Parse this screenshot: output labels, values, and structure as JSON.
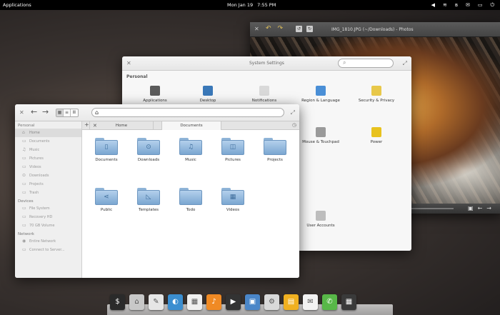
{
  "panel": {
    "applications_label": "Applications",
    "date": "Mon Jan 19",
    "time": "7:55 PM",
    "indicators": [
      {
        "icon": "volume-icon",
        "glyph": "◀"
      },
      {
        "icon": "wifi-icon",
        "glyph": "≋"
      },
      {
        "icon": "bluetooth-icon",
        "glyph": "ʙ"
      },
      {
        "icon": "mail-icon",
        "glyph": "✉"
      },
      {
        "icon": "battery-icon",
        "glyph": "▭"
      },
      {
        "icon": "power-icon",
        "glyph": "⏻"
      }
    ]
  },
  "photos": {
    "title": "IMG_1810.JPG (~/Downloads) - Photos"
  },
  "settings": {
    "title": "System Settings",
    "search_placeholder": "",
    "personal_section": "Personal",
    "items": [
      {
        "name": "settings-applications",
        "label": "Applications",
        "color": "#5a5a5a"
      },
      {
        "name": "settings-desktop",
        "label": "Desktop",
        "color": "#3a78b8"
      },
      {
        "name": "settings-notifications",
        "label": "Notifications",
        "color": "#d9d9d9"
      },
      {
        "name": "settings-region-language",
        "label": "Region & Language",
        "color": "#4a8fd6"
      },
      {
        "name": "settings-security-privacy",
        "label": "Security & Privacy",
        "color": "#e8c84a"
      },
      {
        "name": "settings-mouse-touchpad",
        "label": "Mouse & Touchpad",
        "color": "#9a9a9a"
      },
      {
        "name": "settings-power",
        "label": "Power",
        "color": "#e8c21e"
      },
      {
        "name": "settings-user-accounts",
        "label": "User Accounts",
        "color": "#bdbdbd"
      }
    ]
  },
  "files": {
    "sidebar": {
      "personal": "Personal",
      "personal_items": [
        {
          "label": "Home",
          "glyph": "⌂"
        },
        {
          "label": "Documents",
          "glyph": "▭"
        },
        {
          "label": "Music",
          "glyph": "♫"
        },
        {
          "label": "Pictures",
          "glyph": "▭"
        },
        {
          "label": "Videos",
          "glyph": "▭"
        },
        {
          "label": "Downloads",
          "glyph": "⊙"
        },
        {
          "label": "Projects",
          "glyph": "▭"
        },
        {
          "label": "Trash",
          "glyph": "▭"
        }
      ],
      "devices": "Devices",
      "device_items": [
        {
          "label": "File System",
          "glyph": "▭"
        },
        {
          "label": "Recovery HD",
          "glyph": "▭"
        },
        {
          "label": "70 GB Volume",
          "glyph": "▭"
        }
      ],
      "network": "Network",
      "network_items": [
        {
          "label": "Entire Network",
          "glyph": "◉"
        },
        {
          "label": "Connect to Server...",
          "glyph": "▭"
        }
      ]
    },
    "tabs": [
      {
        "label": "Home"
      },
      {
        "label": "Documents"
      }
    ],
    "folders": [
      {
        "label": "Documents",
        "glyph": "▯"
      },
      {
        "label": "Downloads",
        "glyph": "⊙"
      },
      {
        "label": "Music",
        "glyph": "♫"
      },
      {
        "label": "Pictures",
        "glyph": "◫"
      },
      {
        "label": "Projects",
        "glyph": ""
      },
      {
        "label": "Public",
        "glyph": "⋖"
      },
      {
        "label": "Templates",
        "glyph": "◺"
      },
      {
        "label": "Todo",
        "glyph": ""
      },
      {
        "label": "Videos",
        "glyph": "▦"
      }
    ]
  },
  "dock": {
    "apps": [
      {
        "name": "dock-terminal",
        "color": "#2a2a2a",
        "glyph": "$"
      },
      {
        "name": "dock-files",
        "color": "#c8c8c8",
        "glyph": "⌂"
      },
      {
        "name": "dock-scratch",
        "color": "#e6e6e6",
        "glyph": "✎"
      },
      {
        "name": "dock-midori",
        "color": "#3b8ed0",
        "glyph": "◐"
      },
      {
        "name": "dock-calendar",
        "color": "#f0f0f0",
        "glyph": "▦"
      },
      {
        "name": "dock-music",
        "color": "#f08a24",
        "glyph": "♪"
      },
      {
        "name": "dock-videos",
        "color": "#333333",
        "glyph": "▶"
      },
      {
        "name": "dock-photos",
        "color": "#4a86c8",
        "glyph": "▣"
      },
      {
        "name": "dock-switchboard",
        "color": "#d9d9d9",
        "glyph": "⚙"
      },
      {
        "name": "dock-appcenter",
        "color": "#f0b020",
        "glyph": "▤"
      },
      {
        "name": "dock-mail",
        "color": "#f2f2f2",
        "glyph": "✉"
      },
      {
        "name": "dock-chat",
        "color": "#58b848",
        "glyph": "✆"
      },
      {
        "name": "dock-screenshot",
        "color": "#3a3a3a",
        "glyph": "▦"
      }
    ]
  }
}
